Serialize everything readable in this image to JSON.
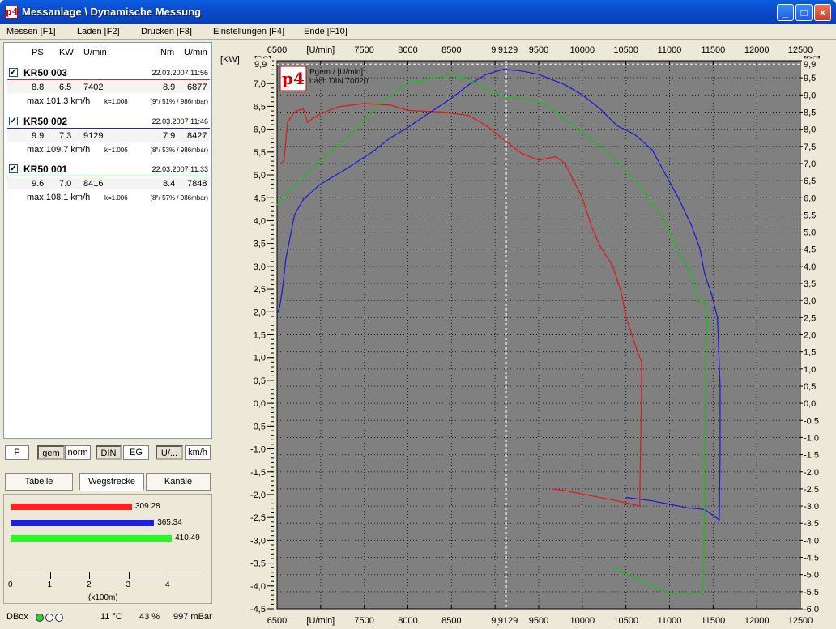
{
  "window": {
    "title": "Messanlage \\ Dynamische Messung",
    "icon": "p4"
  },
  "menu": [
    {
      "label": "Messen [F1]"
    },
    {
      "label": "Laden [F2]"
    },
    {
      "label": "Drucken [F3]"
    },
    {
      "label": "Einstellungen [F4]"
    },
    {
      "label": "Ende [F10]"
    }
  ],
  "list_header": {
    "ps": "PS",
    "kw": "KW",
    "umin": "U/min",
    "nm": "Nm",
    "umin2": "U/min"
  },
  "runs": [
    {
      "name": "KR50 003",
      "date": "22.03.2007 11:56",
      "checked": true,
      "color": "#e02020",
      "ps": "8.8",
      "kw": "6.5",
      "umin": "7402",
      "nm": "8.9",
      "umin2": "6877",
      "max": "max 101.3 km/h",
      "k": "k=1.008",
      "cond": "(9°/ 51% / 986mbar)"
    },
    {
      "name": "KR50 002",
      "date": "22.03.2007 11:46",
      "checked": true,
      "color": "#2020d0",
      "ps": "9.9",
      "kw": "7.3",
      "umin": "9129",
      "nm": "7.9",
      "umin2": "8427",
      "max": "max 109.7 km/h",
      "k": "k=1.006",
      "cond": "(8°/ 53% / 986mbar)"
    },
    {
      "name": "KR50 001",
      "date": "22.03.2007 11:33",
      "checked": true,
      "color": "#20c020",
      "ps": "9.6",
      "kw": "7.0",
      "umin": "8416",
      "nm": "8.4",
      "umin2": "7848",
      "max": "max 108.1 km/h",
      "k": "k=1.006",
      "cond": "(8°/ 57% / 986mbar)"
    }
  ],
  "buttons1": [
    "P",
    "gem",
    "norm",
    "DIN",
    "EG",
    "U/...",
    "km/h"
  ],
  "tabs": [
    "Tabelle",
    "Wegstrecke",
    "Kanäle"
  ],
  "distance": {
    "values": [
      3.0928,
      3.6534,
      4.1049
    ],
    "labels": [
      "309.28",
      "365.34",
      "410.49"
    ],
    "ticks": [
      "0",
      "1",
      "2",
      "3",
      "4"
    ],
    "unit": "(x100m)"
  },
  "status": {
    "label": "DBox",
    "temp": "11 °C",
    "humidity": "43 %",
    "pressure": "997 mBar"
  },
  "chart_data": {
    "type": "line",
    "title": "Pgem / [U/min]",
    "subtitle": "nach DIN 70020",
    "logo": "p4",
    "xlabel": "[U/min]",
    "ylabel_left": "[KW]",
    "ylabel_right": "[PS]",
    "xlim": [
      6500,
      12500
    ],
    "ylim_left": [
      -4.5,
      7.5
    ],
    "ylim_right": [
      -6.0,
      10.0
    ],
    "x_ticks": [
      "6500",
      "7000",
      "7500",
      "8000",
      "8500",
      "9000",
      "9500",
      "10000",
      "10500",
      "11000",
      "11500",
      "12000",
      "12500"
    ],
    "x_tick_labels": [
      "6500",
      "[U/min]",
      "7500",
      "8000",
      "8500",
      "9(",
      "9500",
      "10000",
      "10500",
      "11000",
      "11500",
      "12000",
      "12500"
    ],
    "cursor": {
      "x": 9129,
      "label": "9129",
      "ps": 9.9,
      "left_value": "9,9",
      "right_value": "9,9"
    },
    "grid": true,
    "series": [
      {
        "color": "#e01818",
        "points": [
          [
            6550,
            7.0
          ],
          [
            6580,
            7.1
          ],
          [
            6620,
            8.2
          ],
          [
            6700,
            8.5
          ],
          [
            6800,
            8.6
          ],
          [
            6850,
            8.2
          ],
          [
            6900,
            8.3
          ],
          [
            7000,
            8.45
          ],
          [
            7200,
            8.65
          ],
          [
            7500,
            8.75
          ],
          [
            7800,
            8.7
          ],
          [
            8000,
            8.55
          ],
          [
            8400,
            8.5
          ],
          [
            8700,
            8.4
          ],
          [
            8900,
            8.1
          ],
          [
            9100,
            7.7
          ],
          [
            9300,
            7.3
          ],
          [
            9500,
            7.1
          ],
          [
            9700,
            7.2
          ],
          [
            9800,
            7.0
          ],
          [
            9900,
            6.5
          ],
          [
            10000,
            6.0
          ],
          [
            10100,
            5.2
          ],
          [
            10200,
            4.6
          ],
          [
            10350,
            4.0
          ],
          [
            10450,
            3.2
          ],
          [
            10500,
            2.5
          ],
          [
            10550,
            2.15
          ],
          [
            10600,
            1.75
          ],
          [
            10650,
            1.4
          ],
          [
            10680,
            1.2
          ],
          [
            10680,
            0.5
          ],
          [
            10670,
            -1.0
          ],
          [
            10660,
            -2.5
          ],
          [
            10660,
            -3.0
          ],
          [
            10400,
            -2.85
          ],
          [
            10000,
            -2.65
          ],
          [
            9800,
            -2.55
          ],
          [
            9650,
            -2.5
          ]
        ]
      },
      {
        "color": "#1818d8",
        "points": [
          [
            6500,
            2.6
          ],
          [
            6530,
            2.8
          ],
          [
            6560,
            3.3
          ],
          [
            6600,
            4.2
          ],
          [
            6700,
            5.5
          ],
          [
            6800,
            5.95
          ],
          [
            7000,
            6.4
          ],
          [
            7300,
            6.85
          ],
          [
            7600,
            7.35
          ],
          [
            7800,
            7.75
          ],
          [
            8000,
            8.05
          ],
          [
            8200,
            8.4
          ],
          [
            8500,
            8.9
          ],
          [
            8700,
            9.3
          ],
          [
            8900,
            9.6
          ],
          [
            9100,
            9.75
          ],
          [
            9300,
            9.7
          ],
          [
            9500,
            9.6
          ],
          [
            9800,
            9.3
          ],
          [
            10000,
            9.0
          ],
          [
            10200,
            8.6
          ],
          [
            10400,
            8.1
          ],
          [
            10600,
            7.85
          ],
          [
            10800,
            7.4
          ],
          [
            10950,
            6.7
          ],
          [
            11100,
            6.0
          ],
          [
            11250,
            5.2
          ],
          [
            11350,
            4.5
          ],
          [
            11400,
            3.8
          ],
          [
            11480,
            3.2
          ],
          [
            11550,
            2.5
          ],
          [
            11580,
            0.5
          ],
          [
            11580,
            -1.5
          ],
          [
            11570,
            -3.4
          ],
          [
            11400,
            -3.1
          ],
          [
            11200,
            -3.05
          ],
          [
            11000,
            -2.95
          ],
          [
            10800,
            -2.85
          ],
          [
            10500,
            -2.75
          ]
        ]
      },
      {
        "color": "#18c018",
        "points": [
          [
            6500,
            5.8
          ],
          [
            6600,
            6.1
          ],
          [
            6800,
            6.6
          ],
          [
            7100,
            7.3
          ],
          [
            7400,
            8.0
          ],
          [
            7700,
            8.8
          ],
          [
            8000,
            9.35
          ],
          [
            8300,
            9.5
          ],
          [
            8500,
            9.6
          ],
          [
            8700,
            9.45
          ],
          [
            8900,
            9.15
          ],
          [
            9100,
            8.95
          ],
          [
            9400,
            8.85
          ],
          [
            9600,
            8.7
          ],
          [
            9800,
            8.3
          ],
          [
            10000,
            7.9
          ],
          [
            10300,
            7.3
          ],
          [
            10500,
            6.8
          ],
          [
            10700,
            6.2
          ],
          [
            10900,
            5.5
          ],
          [
            11000,
            5.0
          ],
          [
            11100,
            4.4
          ],
          [
            11200,
            4.0
          ],
          [
            11280,
            3.6
          ],
          [
            11320,
            3.0
          ],
          [
            11350,
            2.9
          ],
          [
            11400,
            3.0
          ],
          [
            11420,
            2.7
          ],
          [
            11450,
            2.3
          ],
          [
            11430,
            2.4
          ],
          [
            11410,
            0.5
          ],
          [
            11400,
            -1.5
          ],
          [
            11400,
            -3.5
          ],
          [
            11380,
            -5.5
          ],
          [
            11300,
            -5.55
          ],
          [
            11000,
            -5.55
          ],
          [
            10800,
            -5.3
          ],
          [
            10600,
            -5.1
          ],
          [
            10350,
            -4.8
          ]
        ]
      }
    ]
  }
}
